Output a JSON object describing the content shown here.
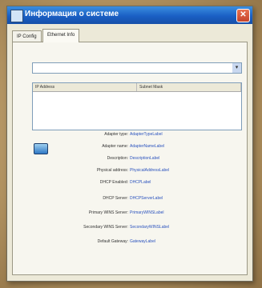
{
  "window": {
    "title": "Информация о системе",
    "close_glyph": "✕",
    "app_icon": "window-app-icon"
  },
  "tabs": [
    {
      "label": "IP Config",
      "active": false
    },
    {
      "label": "Ethernet Info",
      "active": true
    }
  ],
  "adapter_select": {
    "value": "",
    "arrow": "▾"
  },
  "list": {
    "columns": [
      "IP Address",
      "Subnet Mask"
    ]
  },
  "details": [
    {
      "label": "Adapter type:",
      "value": "AdapterTypeLabel"
    },
    {
      "label": "Adapter name:",
      "value": "AdapterNameLabel"
    },
    {
      "label": "Description:",
      "value": "DescriptionLabel"
    },
    {
      "label": "Physical address:",
      "value": "PhysicalAddressLabel"
    },
    {
      "label": "DHCP Enabled:",
      "value": "DHCPLabel"
    },
    {
      "label": "DHCP Server:",
      "value": "DHCPServerLabel"
    },
    {
      "label": "Primary WINS Server:",
      "value": "PrimaryWINSLabel"
    },
    {
      "label": "Secondary WINS Server:",
      "value": "SecondaryWINSLabel"
    },
    {
      "label": "Default Gateway:",
      "value": "GatewayLabel"
    }
  ],
  "colors": {
    "link": "#2a52be",
    "titlebar": "#1a5fc4"
  }
}
